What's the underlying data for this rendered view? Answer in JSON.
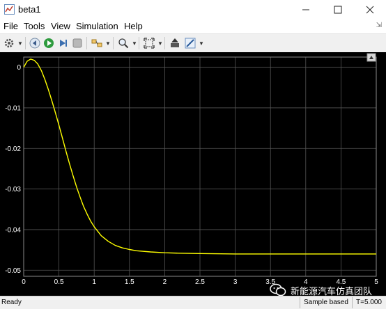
{
  "window": {
    "title": "beta1",
    "minimize_icon": "minimize-icon",
    "maximize_icon": "maximize-icon",
    "close_icon": "close-icon"
  },
  "menu": {
    "items": [
      "File",
      "Tools",
      "View",
      "Simulation",
      "Help"
    ]
  },
  "toolbar": {
    "buttons": [
      "settings-gear-icon",
      "step-back-icon",
      "run-icon",
      "step-forward-icon",
      "stop-icon",
      "highlight-block-icon",
      "zoom-icon",
      "autoscale-icon",
      "cursor-measurements-icon",
      "triggers-icon"
    ]
  },
  "status": {
    "ready": "Ready",
    "mode": "Sample based",
    "time": "T=5.000"
  },
  "watermark": {
    "text": "新能源汽车仿真团队"
  },
  "colors": {
    "scope_bg": "#000000",
    "grid": "#555555",
    "trace": "#ffff00",
    "axis_text": "#ffffff"
  },
  "chart_data": {
    "type": "line",
    "xlim": [
      0,
      5
    ],
    "ylim": [
      -0.0515,
      0.0025
    ],
    "xticks": [
      0,
      0.5,
      1,
      1.5,
      2,
      2.5,
      3,
      3.5,
      4,
      4.5,
      5
    ],
    "xtick_labels": [
      "0",
      "0.5",
      "1",
      "1.5",
      "2",
      "2.5",
      "3",
      "3.5",
      "4",
      "4.5",
      "5"
    ],
    "yticks": [
      0,
      -0.01,
      -0.02,
      -0.03,
      -0.04,
      -0.05
    ],
    "ytick_labels": [
      "0",
      "-0.01",
      "-0.02",
      "-0.03",
      "-0.04",
      "-0.05"
    ],
    "grid": true,
    "series": [
      {
        "color": "#ffff00",
        "x": [
          0,
          0.05,
          0.1,
          0.15,
          0.2,
          0.25,
          0.3,
          0.35,
          0.4,
          0.45,
          0.5,
          0.55,
          0.6,
          0.65,
          0.7,
          0.75,
          0.8,
          0.85,
          0.9,
          0.95,
          1.0,
          1.1,
          1.2,
          1.3,
          1.4,
          1.5,
          1.6,
          1.8,
          2.0,
          2.2,
          2.5,
          3.0,
          3.5,
          4.0,
          4.5,
          5.0
        ],
        "y": [
          0,
          0.0015,
          0.002,
          0.0017,
          0.0008,
          -0.0008,
          -0.003,
          -0.0055,
          -0.0083,
          -0.0112,
          -0.0143,
          -0.0175,
          -0.0207,
          -0.0238,
          -0.0267,
          -0.0295,
          -0.032,
          -0.0343,
          -0.0362,
          -0.0379,
          -0.0393,
          -0.0415,
          -0.0429,
          -0.0439,
          -0.0445,
          -0.0449,
          -0.0452,
          -0.0455,
          -0.0457,
          -0.0458,
          -0.0459,
          -0.046,
          -0.046,
          -0.046,
          -0.046,
          -0.046
        ]
      }
    ]
  }
}
